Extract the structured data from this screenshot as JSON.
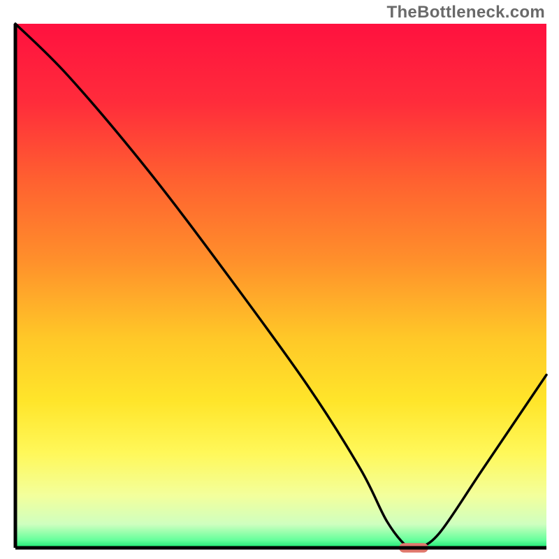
{
  "watermark": "TheBottleneck.com",
  "chart_data": {
    "type": "line",
    "title": "",
    "xlabel": "",
    "ylabel": "",
    "ylim": [
      0,
      100
    ],
    "xlim": [
      0,
      100
    ],
    "background": {
      "fill": "vertical-gradient",
      "stops": [
        {
          "offset": 0.0,
          "color": "#ff113f"
        },
        {
          "offset": 0.15,
          "color": "#ff2c3b"
        },
        {
          "offset": 0.3,
          "color": "#ff6130"
        },
        {
          "offset": 0.45,
          "color": "#ff8f2b"
        },
        {
          "offset": 0.6,
          "color": "#ffc828"
        },
        {
          "offset": 0.72,
          "color": "#ffe52a"
        },
        {
          "offset": 0.82,
          "color": "#fff85a"
        },
        {
          "offset": 0.9,
          "color": "#f3ff9c"
        },
        {
          "offset": 0.955,
          "color": "#cfffbf"
        },
        {
          "offset": 0.985,
          "color": "#66ff9c"
        },
        {
          "offset": 1.0,
          "color": "#18e870"
        }
      ]
    },
    "series": [
      {
        "name": "bottleneck-curve",
        "color": "#000000",
        "x": [
          0,
          10,
          25,
          40,
          55,
          65,
          70,
          74,
          76,
          80,
          88,
          100
        ],
        "values": [
          100,
          90,
          72,
          52,
          31,
          15,
          5,
          0,
          0,
          3,
          15,
          33
        ]
      }
    ],
    "marker": {
      "name": "selected-point",
      "x": 75,
      "y": 0,
      "color": "#e0786d",
      "width": 5.5,
      "height": 1.8
    },
    "axes": {
      "color": "#000000",
      "thickness": 5,
      "show_ticks": false,
      "show_gridlines": false
    }
  }
}
